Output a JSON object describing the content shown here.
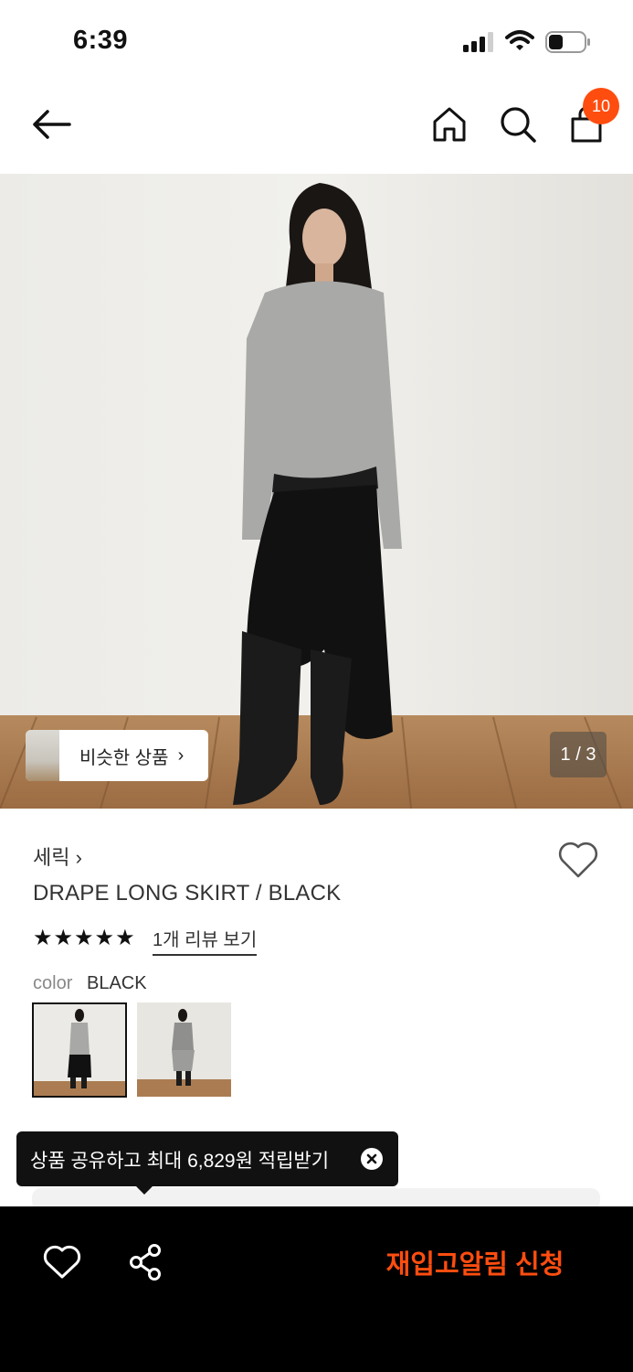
{
  "status_bar": {
    "time": "6:39"
  },
  "header": {
    "cart_count": "10"
  },
  "gallery": {
    "similar_products_label": "비슷한 상품",
    "similar_chevron": "›",
    "page_counter": "1 / 3"
  },
  "product": {
    "brand": "세릭 ›",
    "title": "DRAPE LONG SKIRT / BLACK",
    "stars": "★★★★★",
    "rating_value": 5,
    "review_link": "1개 리뷰 보기",
    "color_label": "color",
    "color_value": "BLACK"
  },
  "share_tooltip": {
    "text": "상품 공유하고 최대 6,829원 적립받기"
  },
  "bottom_bar": {
    "restock_label": "재입고알림 신청"
  },
  "colors": {
    "accent": "#ff4d0f",
    "bottom_bar_bg": "#000000",
    "tooltip_bg": "#111111"
  },
  "icons": [
    "back-arrow-icon",
    "home-icon",
    "search-icon",
    "shopping-bag-icon",
    "heart-icon",
    "share-icon",
    "close-icon",
    "chevron-right-icon",
    "star-icon",
    "signal-icon",
    "wifi-icon",
    "battery-icon"
  ]
}
